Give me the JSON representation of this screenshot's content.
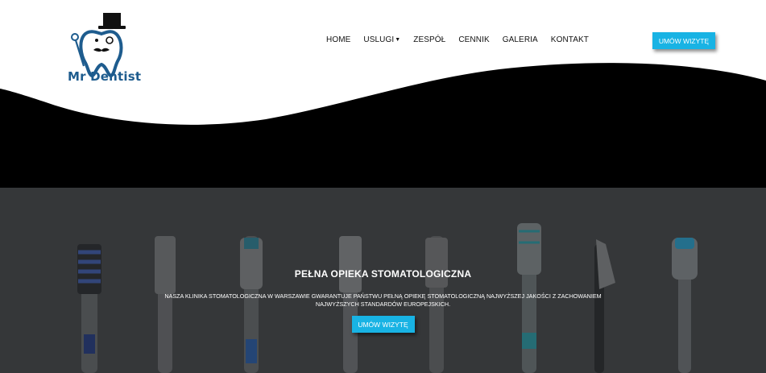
{
  "brand": {
    "name": "Mr Dentist",
    "color": "#1e5c8e"
  },
  "nav": {
    "items": [
      {
        "label": "HOME"
      },
      {
        "label": "USLUGI",
        "has_dropdown": true
      },
      {
        "label": "ZESPÓŁ"
      },
      {
        "label": "CENNIK"
      },
      {
        "label": "GALERIA"
      },
      {
        "label": "KONTAKT"
      }
    ],
    "dropdown_icon": "caret-down-icon"
  },
  "header": {
    "cta_label": "UMÓW WIZYTĘ",
    "accent": "#18b3e4"
  },
  "hero": {
    "title": "PEŁNA OPIEKA STOMATOLOGICZNA",
    "text": "NASZA KLINIKA STOMATOLOGICZNA W WARSZAWIE GWARANTUJE PAŃSTWU PEŁNĄ OPIEKĘ STOMATOLOGICZNĄ NAJWYŻSZEJ JAKOŚCI Z ZACHOWANIEM NAJWYŻSZYCH STANDARDÓW EUROPEJSKICH.",
    "cta_label": "UMÓW WIZYTĘ",
    "background": "toothbrushes-photo"
  }
}
